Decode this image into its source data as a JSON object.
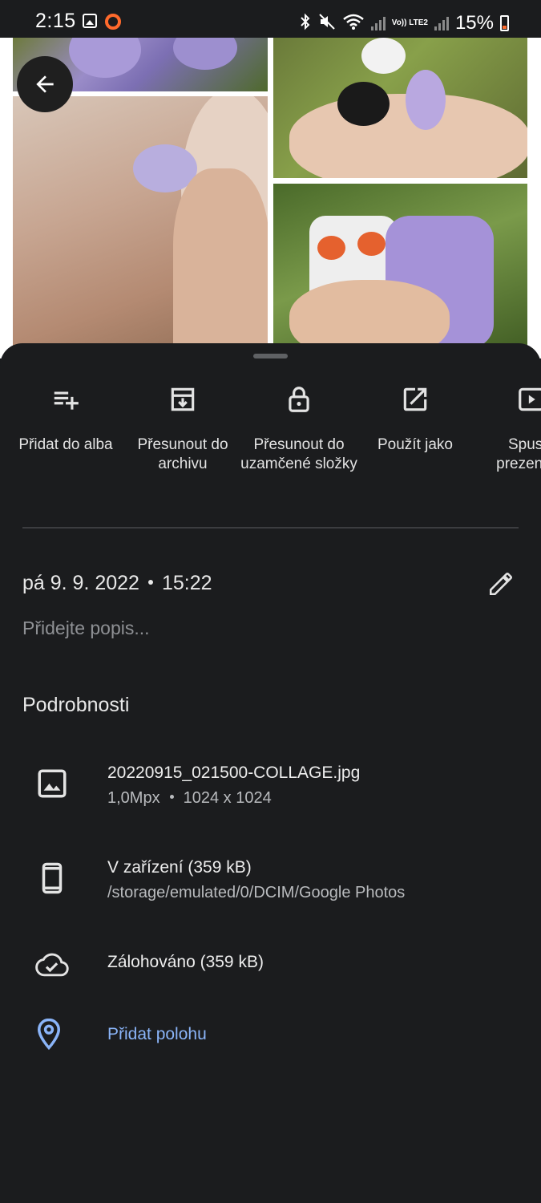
{
  "status_bar": {
    "time": "2:15",
    "battery": "15%",
    "network_label": "Vo)) LTE2",
    "icons": [
      "gallery-icon",
      "screen-record-icon",
      "bluetooth-icon",
      "mute-icon",
      "wifi-icon",
      "signal-icon",
      "battery-icon"
    ]
  },
  "photo": {
    "description_icon": "collage-image",
    "back_icon": "arrow-back-icon"
  },
  "actions": [
    {
      "label": "Přidat do alba",
      "icon": "playlist-add-icon"
    },
    {
      "label": "Přesunout do archivu",
      "icon": "archive-icon"
    },
    {
      "label": "Přesunout do uzamčené složky",
      "icon": "lock-icon"
    },
    {
      "label": "Použít jako",
      "icon": "open-in-new-icon"
    },
    {
      "label": "Spustit prezentaci",
      "icon": "slideshow-icon"
    }
  ],
  "info": {
    "date": "pá 9. 9. 2022",
    "time": "15:22",
    "description_placeholder": "Přidejte popis...",
    "edit_icon": "pencil-icon"
  },
  "details": {
    "title": "Podrobnosti",
    "file": {
      "name": "20220915_021500-COLLAGE.jpg",
      "megapixels": "1,0Mpx",
      "resolution": "1024 x 1024",
      "icon": "image-icon"
    },
    "device": {
      "label": "V zařízení (359 kB)",
      "path": "/storage/emulated/0/DCIM/Google Photos",
      "icon": "phone-icon"
    },
    "backup": {
      "label": "Zálohováno (359 kB)",
      "icon": "cloud-done-icon"
    },
    "location": {
      "label": "Přidat polohu",
      "icon": "location-pin-icon"
    }
  },
  "colors": {
    "background": "#1b1c1e",
    "link": "#8ab4f8",
    "text": "#e3e3e3",
    "muted": "#8e9094"
  }
}
